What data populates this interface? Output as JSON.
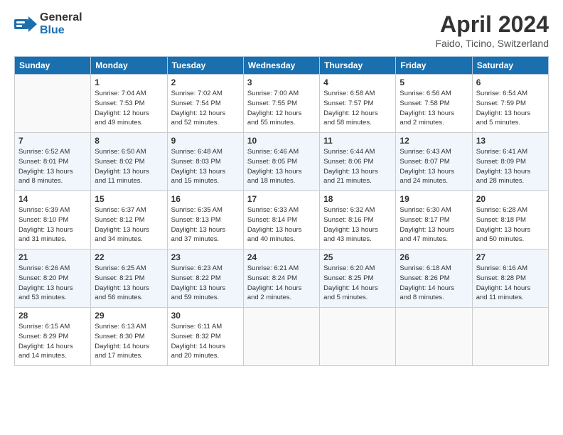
{
  "header": {
    "logo_general": "General",
    "logo_blue": "Blue",
    "month_title": "April 2024",
    "subtitle": "Faido, Ticino, Switzerland"
  },
  "days_of_week": [
    "Sunday",
    "Monday",
    "Tuesday",
    "Wednesday",
    "Thursday",
    "Friday",
    "Saturday"
  ],
  "weeks": [
    [
      {
        "day": "",
        "info": ""
      },
      {
        "day": "1",
        "info": "Sunrise: 7:04 AM\nSunset: 7:53 PM\nDaylight: 12 hours\nand 49 minutes."
      },
      {
        "day": "2",
        "info": "Sunrise: 7:02 AM\nSunset: 7:54 PM\nDaylight: 12 hours\nand 52 minutes."
      },
      {
        "day": "3",
        "info": "Sunrise: 7:00 AM\nSunset: 7:55 PM\nDaylight: 12 hours\nand 55 minutes."
      },
      {
        "day": "4",
        "info": "Sunrise: 6:58 AM\nSunset: 7:57 PM\nDaylight: 12 hours\nand 58 minutes."
      },
      {
        "day": "5",
        "info": "Sunrise: 6:56 AM\nSunset: 7:58 PM\nDaylight: 13 hours\nand 2 minutes."
      },
      {
        "day": "6",
        "info": "Sunrise: 6:54 AM\nSunset: 7:59 PM\nDaylight: 13 hours\nand 5 minutes."
      }
    ],
    [
      {
        "day": "7",
        "info": "Sunrise: 6:52 AM\nSunset: 8:01 PM\nDaylight: 13 hours\nand 8 minutes."
      },
      {
        "day": "8",
        "info": "Sunrise: 6:50 AM\nSunset: 8:02 PM\nDaylight: 13 hours\nand 11 minutes."
      },
      {
        "day": "9",
        "info": "Sunrise: 6:48 AM\nSunset: 8:03 PM\nDaylight: 13 hours\nand 15 minutes."
      },
      {
        "day": "10",
        "info": "Sunrise: 6:46 AM\nSunset: 8:05 PM\nDaylight: 13 hours\nand 18 minutes."
      },
      {
        "day": "11",
        "info": "Sunrise: 6:44 AM\nSunset: 8:06 PM\nDaylight: 13 hours\nand 21 minutes."
      },
      {
        "day": "12",
        "info": "Sunrise: 6:43 AM\nSunset: 8:07 PM\nDaylight: 13 hours\nand 24 minutes."
      },
      {
        "day": "13",
        "info": "Sunrise: 6:41 AM\nSunset: 8:09 PM\nDaylight: 13 hours\nand 28 minutes."
      }
    ],
    [
      {
        "day": "14",
        "info": "Sunrise: 6:39 AM\nSunset: 8:10 PM\nDaylight: 13 hours\nand 31 minutes."
      },
      {
        "day": "15",
        "info": "Sunrise: 6:37 AM\nSunset: 8:12 PM\nDaylight: 13 hours\nand 34 minutes."
      },
      {
        "day": "16",
        "info": "Sunrise: 6:35 AM\nSunset: 8:13 PM\nDaylight: 13 hours\nand 37 minutes."
      },
      {
        "day": "17",
        "info": "Sunrise: 6:33 AM\nSunset: 8:14 PM\nDaylight: 13 hours\nand 40 minutes."
      },
      {
        "day": "18",
        "info": "Sunrise: 6:32 AM\nSunset: 8:16 PM\nDaylight: 13 hours\nand 43 minutes."
      },
      {
        "day": "19",
        "info": "Sunrise: 6:30 AM\nSunset: 8:17 PM\nDaylight: 13 hours\nand 47 minutes."
      },
      {
        "day": "20",
        "info": "Sunrise: 6:28 AM\nSunset: 8:18 PM\nDaylight: 13 hours\nand 50 minutes."
      }
    ],
    [
      {
        "day": "21",
        "info": "Sunrise: 6:26 AM\nSunset: 8:20 PM\nDaylight: 13 hours\nand 53 minutes."
      },
      {
        "day": "22",
        "info": "Sunrise: 6:25 AM\nSunset: 8:21 PM\nDaylight: 13 hours\nand 56 minutes."
      },
      {
        "day": "23",
        "info": "Sunrise: 6:23 AM\nSunset: 8:22 PM\nDaylight: 13 hours\nand 59 minutes."
      },
      {
        "day": "24",
        "info": "Sunrise: 6:21 AM\nSunset: 8:24 PM\nDaylight: 14 hours\nand 2 minutes."
      },
      {
        "day": "25",
        "info": "Sunrise: 6:20 AM\nSunset: 8:25 PM\nDaylight: 14 hours\nand 5 minutes."
      },
      {
        "day": "26",
        "info": "Sunrise: 6:18 AM\nSunset: 8:26 PM\nDaylight: 14 hours\nand 8 minutes."
      },
      {
        "day": "27",
        "info": "Sunrise: 6:16 AM\nSunset: 8:28 PM\nDaylight: 14 hours\nand 11 minutes."
      }
    ],
    [
      {
        "day": "28",
        "info": "Sunrise: 6:15 AM\nSunset: 8:29 PM\nDaylight: 14 hours\nand 14 minutes."
      },
      {
        "day": "29",
        "info": "Sunrise: 6:13 AM\nSunset: 8:30 PM\nDaylight: 14 hours\nand 17 minutes."
      },
      {
        "day": "30",
        "info": "Sunrise: 6:11 AM\nSunset: 8:32 PM\nDaylight: 14 hours\nand 20 minutes."
      },
      {
        "day": "",
        "info": ""
      },
      {
        "day": "",
        "info": ""
      },
      {
        "day": "",
        "info": ""
      },
      {
        "day": "",
        "info": ""
      }
    ]
  ],
  "row_shades": [
    "white",
    "shade",
    "white",
    "shade",
    "white"
  ]
}
